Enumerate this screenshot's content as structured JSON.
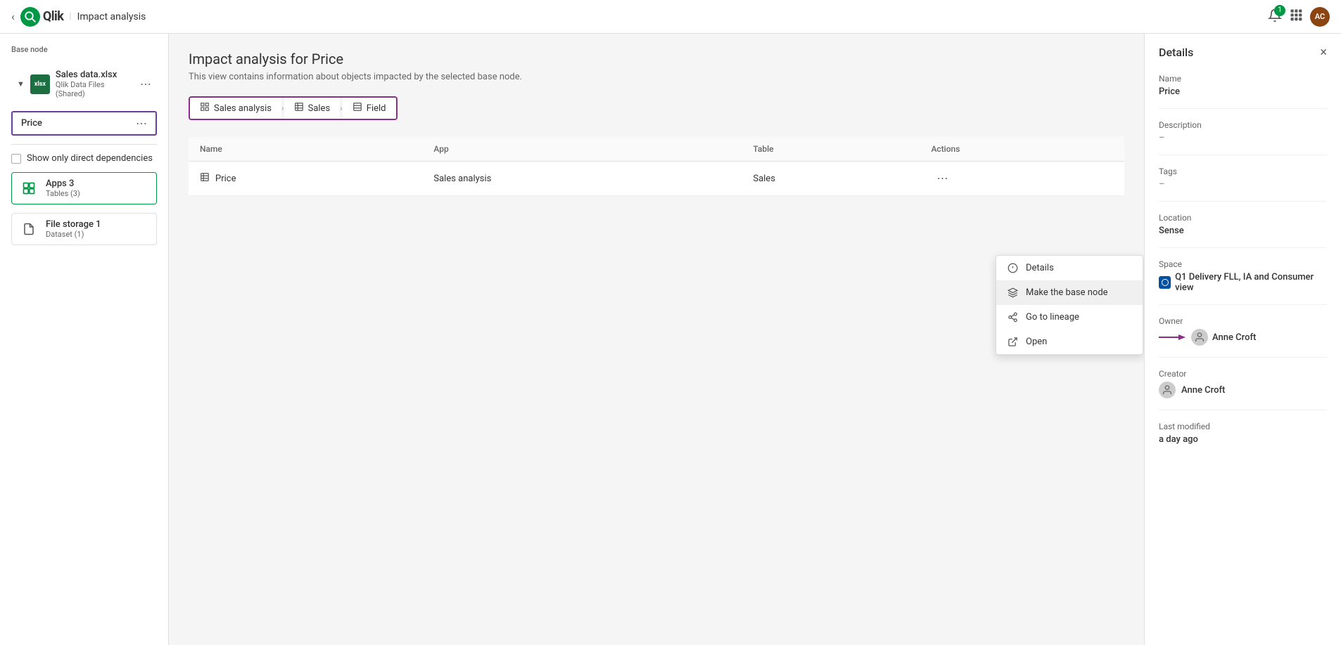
{
  "topbar": {
    "title": "Impact analysis",
    "back_label": "←",
    "logo_text": "Qlik",
    "logo_abbr": "Q",
    "notifications_count": "1",
    "avatar_initials": "AC"
  },
  "left_sidebar": {
    "base_node_label": "Base node",
    "file_node": {
      "name": "Sales data.xlsx",
      "sub": "Qlik Data Files (Shared)"
    },
    "price_node": {
      "label": "Price"
    },
    "direct_deps_label": "Show only direct dependencies",
    "deps": [
      {
        "name": "Apps",
        "count": "3",
        "sub": "Tables (3)",
        "type": "apps"
      },
      {
        "name": "File storage",
        "count": "1",
        "sub": "Dataset (1)",
        "type": "file"
      }
    ]
  },
  "breadcrumb": {
    "items": [
      {
        "label": "Sales analysis",
        "icon": "chart"
      },
      {
        "label": "Sales",
        "icon": "table"
      },
      {
        "label": "Field",
        "icon": "field"
      }
    ]
  },
  "main": {
    "title": "Impact analysis for Price",
    "subtitle": "This view contains information about objects impacted by the selected base node.",
    "table": {
      "columns": [
        "Name",
        "App",
        "Table",
        "Actions"
      ],
      "rows": [
        {
          "name": "Price",
          "icon": "table-row-icon",
          "app": "Sales analysis",
          "table": "Sales"
        }
      ]
    }
  },
  "context_menu": {
    "items": [
      {
        "label": "Details",
        "icon": "info"
      },
      {
        "label": "Make the base node",
        "icon": "lineage"
      },
      {
        "label": "Go to lineage",
        "icon": "lineage2"
      },
      {
        "label": "Open",
        "icon": "open"
      }
    ]
  },
  "right_panel": {
    "title": "Details",
    "close_label": "×",
    "name_label": "Name",
    "name_value": "Price",
    "description_label": "Description",
    "description_value": "–",
    "tags_label": "Tags",
    "tags_value": "–",
    "location_label": "Location",
    "location_value": "Sense",
    "space_label": "Space",
    "space_value": "Q1 Delivery FLL, IA and Consumer view",
    "owner_label": "Owner",
    "owner_value": "Anne Croft",
    "creator_label": "Creator",
    "creator_value": "Anne Croft",
    "last_modified_label": "Last modified",
    "last_modified_value": "a day ago"
  }
}
